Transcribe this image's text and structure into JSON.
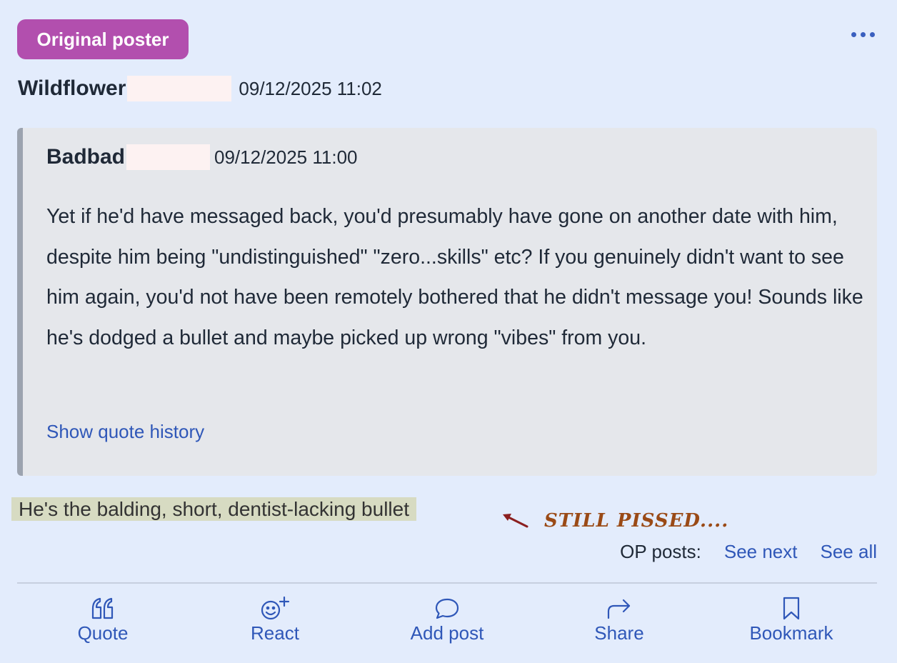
{
  "badge": {
    "label": "Original poster"
  },
  "post": {
    "author": "Wildflower",
    "timestamp": "09/12/2025 11:02",
    "reply_text": "He's the balding, short, dentist-lacking bullet"
  },
  "quote": {
    "author": "Badbad",
    "timestamp": "09/12/2025 11:00",
    "body": "Yet if he'd have messaged back, you'd presumably have gone on another date with him, despite him being \"undistinguished\" \"zero...skills\" etc? If you genuinely didn't want to see him again, you'd not have been remotely bothered that he didn't message you! Sounds like he's dodged a bullet and maybe picked up wrong \"vibes\" from you.",
    "history_link": "Show quote history"
  },
  "annotation": {
    "text": "STILL PISSED....",
    "color": "#9a4a16"
  },
  "op_posts": {
    "label": "OP posts:",
    "next": "See next",
    "all": "See all"
  },
  "actions": [
    {
      "label": "Quote",
      "icon": "quote-icon"
    },
    {
      "label": "React",
      "icon": "react-icon"
    },
    {
      "label": "Add post",
      "icon": "speech-bubble-icon"
    },
    {
      "label": "Share",
      "icon": "share-arrow-icon"
    },
    {
      "label": "Bookmark",
      "icon": "bookmark-icon"
    }
  ],
  "colors": {
    "accent": "#2f57b8",
    "badge": "#b24fae",
    "background": "#e3ecfc",
    "quote_bg": "#e5e7eb",
    "highlight": "#d7dbc2"
  }
}
